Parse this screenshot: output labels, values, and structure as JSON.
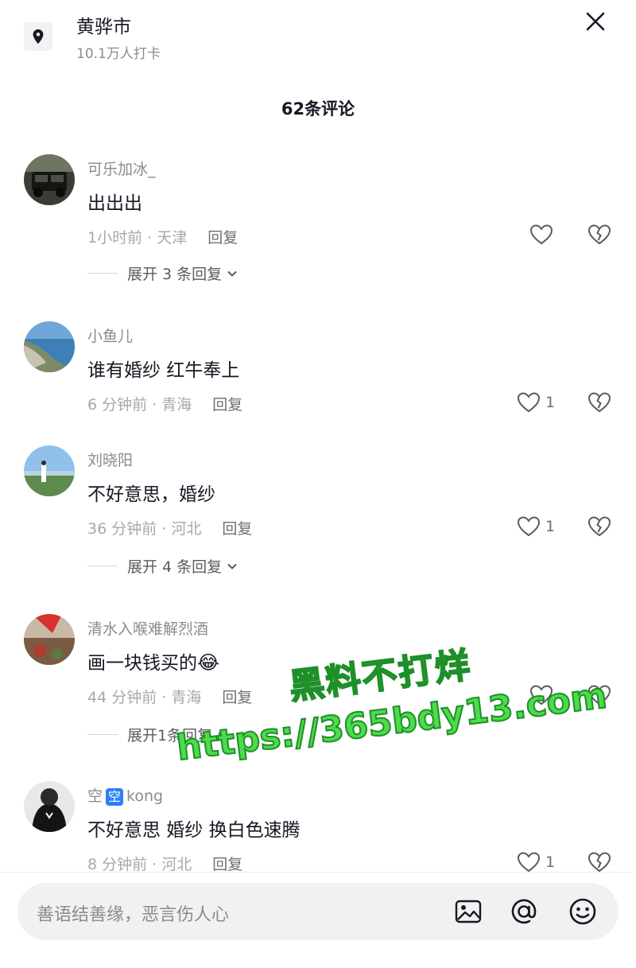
{
  "header": {
    "location_name": "黄骅市",
    "checkin_count": "10.1万人打卡"
  },
  "comments_title": "62条评论",
  "comments": [
    {
      "username": "可乐加冰_",
      "text": "出出出",
      "time_location": "1小时前 · 天津",
      "reply_label": "回复",
      "like_count": "",
      "expand_label": "展开 3 条回复"
    },
    {
      "username": "小鱼儿",
      "text": "谁有婚纱 红牛奉上",
      "time_location": "6 分钟前 · 青海",
      "reply_label": "回复",
      "like_count": "1",
      "expand_label": ""
    },
    {
      "username": "刘晓阳",
      "text": "不好意思，婚纱",
      "time_location": "36 分钟前 · 河北",
      "reply_label": "回复",
      "like_count": "1",
      "expand_label": "展开 4 条回复"
    },
    {
      "username": "清水入喉难解烈酒",
      "text": "画一块钱买的",
      "emoji": "😂",
      "time_location": "44 分钟前 · 青海",
      "reply_label": "回复",
      "like_count": "",
      "expand_label": "展开1条回复"
    },
    {
      "username_prefix": "空",
      "username_badge": "空",
      "username_suffix": "kong",
      "text": "不好意思  婚纱 换白色速腾",
      "time_location": "8 分钟前 · 河北",
      "reply_label": "回复",
      "like_count": "1",
      "expand_label": ""
    }
  ],
  "watermark": {
    "line1": "黑料不打烊",
    "line2": "https://365bdy13.com"
  },
  "input": {
    "placeholder": "善语结善缘，恶言伤人心"
  },
  "icons": {
    "location": "map-pin-icon",
    "close": "close-icon",
    "like": "heart-outline-icon",
    "dislike": "broken-heart-icon",
    "image": "image-icon",
    "mention": "at-icon",
    "emoji": "smile-icon"
  }
}
